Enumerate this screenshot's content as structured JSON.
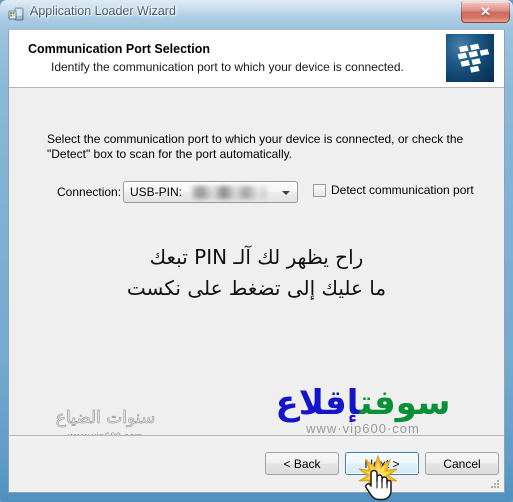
{
  "window": {
    "title": "Application Loader Wizard",
    "title_icon": "device-phone-icon",
    "close_label": "✕",
    "frame_color": "#7fb2d5",
    "close_color": "#c2483d"
  },
  "header": {
    "title": "Communication Port Selection",
    "subtitle": "Identify the communication port to which your device is connected.",
    "logo_icon": "blackberry-logo-icon"
  },
  "main": {
    "instruction_line1": "Select the communication port to which your device is connected, or check the",
    "instruction_line2": "\"Detect\" box to scan for the port automatically.",
    "connection_label": "Connection:",
    "connection_value": "USB-PIN:",
    "connection_pin_redacted": "",
    "detect_checkbox_label": "Detect communication port",
    "detect_checked": false
  },
  "overlay": {
    "arabic_line1": "راح يظهر لك آلـ PIN تبعك",
    "arabic_line2": "ما عليك إلى تضغط على نكست"
  },
  "watermark_right": {
    "word_blue": "إقلاع",
    "word_green": "سوفت",
    "url": "www·vip600·com",
    "blue_hex": "#1414c8",
    "green_hex": "#089038"
  },
  "watermark_left": {
    "text": "سنوات الضياع",
    "url": "www.vip600.com"
  },
  "buttons": {
    "back": "< Back",
    "next": "Next >",
    "cancel": "Cancel"
  },
  "cursor": {
    "icon": "hand-pointer-cursor",
    "burst_icon": "click-burst-icon"
  }
}
